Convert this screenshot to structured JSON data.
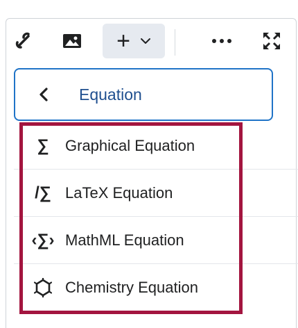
{
  "toolbar": {
    "buttons": [
      {
        "name": "link",
        "icon": "link-icon"
      },
      {
        "name": "image",
        "icon": "image-icon"
      },
      {
        "name": "insert",
        "icon": "plus-icon",
        "has_dropdown": true
      },
      {
        "name": "more",
        "icon": "ellipsis-icon"
      },
      {
        "name": "fullscreen",
        "icon": "fullscreen-icon"
      }
    ],
    "insert_symbol": "+",
    "more_symbol": "•••"
  },
  "submenu": {
    "back_title": "Equation",
    "items": [
      {
        "label": "Graphical Equation",
        "icon": "sigma-icon",
        "glyph": "∑"
      },
      {
        "label": "LaTeX Equation",
        "icon": "latex-sigma-icon",
        "glyph": "/∑"
      },
      {
        "label": "MathML Equation",
        "icon": "mathml-sigma-icon",
        "glyph": "‹∑›"
      },
      {
        "label": "Chemistry Equation",
        "icon": "chemistry-icon",
        "glyph": ""
      }
    ]
  },
  "colors": {
    "accent_border": "#1f73c7",
    "back_title": "#1f4f8f",
    "highlight": "#a3153f",
    "insert_button_bg": "#e6eaf0"
  }
}
